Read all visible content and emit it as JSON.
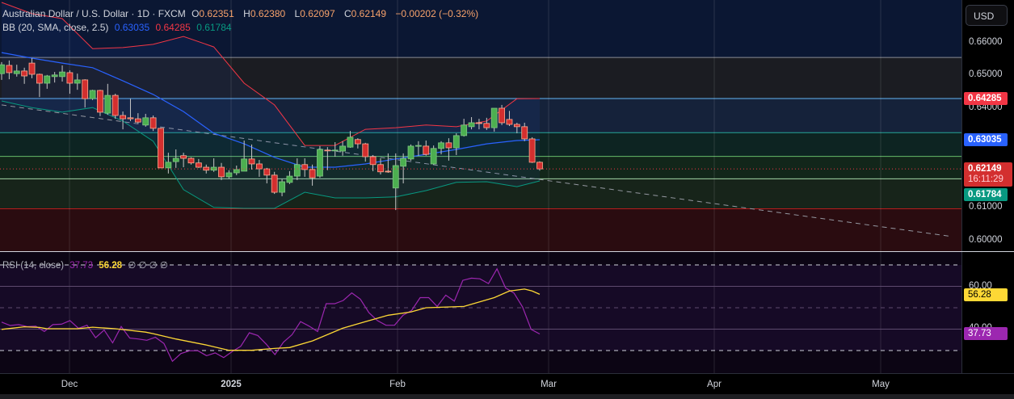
{
  "header": {
    "symbol_title": "Australian Dollar / U.S. Dollar · 1D · FXCM",
    "open_label": "O",
    "open": "0.62351",
    "high_label": "H",
    "high": "0.62380",
    "low_label": "L",
    "low": "0.62097",
    "close_label": "C",
    "close": "0.62149",
    "change": "−0.00202 (−0.32%)"
  },
  "bb_legend": {
    "label": "BB (20, SMA, close, 2.5)",
    "basis": "0.63035",
    "upper": "0.64285",
    "lower": "0.61784"
  },
  "rsi_legend": {
    "label": "RSI (14, close)",
    "rsi": "37.73",
    "ma": "56.28",
    "extras": "∅ ∅ ∅ ∅"
  },
  "price_axis": {
    "currency_button": "USD",
    "labels": [
      "0.66000",
      "0.65000",
      "0.64000",
      "0.61000",
      "0.60000"
    ],
    "badge_upper": "0.64285",
    "badge_basis": "0.63035",
    "badge_last": "0.62149",
    "badge_countdown": "16:11:29",
    "badge_lower": "0.61784"
  },
  "rsi_axis": {
    "labels": [
      "60.00",
      "40.00"
    ],
    "badge_ma": "56.28",
    "badge_rsi": "37.73"
  },
  "time_axis": {
    "labels": [
      "Dec",
      "2025",
      "Feb",
      "Mar",
      "Apr",
      "May"
    ]
  },
  "colors": {
    "up": "#4caf50",
    "down": "#f23645",
    "upper_band": "#f23645",
    "basis": "#2962ff",
    "lower_band": "#089981",
    "rsi": "#9c27b0",
    "rsi_ma": "#fdd835"
  },
  "chart_data": {
    "type": "candlestick",
    "price_range": [
      0.595,
      0.672
    ],
    "candles_ohlc": [
      [
        0.6504,
        0.6539,
        0.6485,
        0.6531
      ],
      [
        0.6529,
        0.6544,
        0.6487,
        0.6507
      ],
      [
        0.6504,
        0.6531,
        0.6495,
        0.6512
      ],
      [
        0.6512,
        0.6522,
        0.6473,
        0.6497
      ],
      [
        0.6536,
        0.6551,
        0.649,
        0.6502
      ],
      [
        0.6502,
        0.6504,
        0.6433,
        0.6475
      ],
      [
        0.6475,
        0.65,
        0.6458,
        0.6497
      ],
      [
        0.6495,
        0.6509,
        0.6477,
        0.65
      ],
      [
        0.6495,
        0.6529,
        0.648,
        0.6509
      ],
      [
        0.6507,
        0.6514,
        0.6443,
        0.6475
      ],
      [
        0.6475,
        0.6504,
        0.6455,
        0.6485
      ],
      [
        0.6485,
        0.6487,
        0.6401,
        0.6428
      ],
      [
        0.6428,
        0.6455,
        0.6424,
        0.6453
      ],
      [
        0.6453,
        0.6455,
        0.6375,
        0.6387
      ],
      [
        0.6384,
        0.6473,
        0.6379,
        0.6438
      ],
      [
        0.6438,
        0.6443,
        0.6367,
        0.6377
      ],
      [
        0.6377,
        0.6389,
        0.6335,
        0.6367
      ],
      [
        0.637,
        0.6428,
        0.636,
        0.6367
      ],
      [
        0.6367,
        0.6384,
        0.6353,
        0.6357
      ],
      [
        0.6348,
        0.6382,
        0.6343,
        0.637
      ],
      [
        0.637,
        0.6377,
        0.633,
        0.6338
      ],
      [
        0.6338,
        0.634,
        0.6218,
        0.6218
      ],
      [
        0.6218,
        0.6264,
        0.6201,
        0.6235
      ],
      [
        0.6237,
        0.6274,
        0.6218,
        0.6247
      ],
      [
        0.6255,
        0.6264,
        0.622,
        0.6247
      ],
      [
        0.6247,
        0.625,
        0.6228,
        0.6233
      ],
      [
        0.6233,
        0.6245,
        0.6218,
        0.622
      ],
      [
        0.622,
        0.6228,
        0.6201,
        0.6211
      ],
      [
        0.6211,
        0.6247,
        0.6206,
        0.622
      ],
      [
        0.622,
        0.6233,
        0.6181,
        0.6191
      ],
      [
        0.6191,
        0.6211,
        0.6186,
        0.6203
      ],
      [
        0.6203,
        0.6225,
        0.6196,
        0.6213
      ],
      [
        0.6208,
        0.6301,
        0.6208,
        0.6245
      ],
      [
        0.6245,
        0.6289,
        0.6213,
        0.623
      ],
      [
        0.623,
        0.6242,
        0.6191,
        0.6215
      ],
      [
        0.6215,
        0.6218,
        0.6171,
        0.6196
      ],
      [
        0.6196,
        0.6206,
        0.6139,
        0.6144
      ],
      [
        0.6144,
        0.6184,
        0.6132,
        0.6176
      ],
      [
        0.6174,
        0.6208,
        0.6169,
        0.6193
      ],
      [
        0.6193,
        0.6247,
        0.6181,
        0.6228
      ],
      [
        0.6228,
        0.6247,
        0.6191,
        0.6213
      ],
      [
        0.6213,
        0.6228,
        0.6164,
        0.6188
      ],
      [
        0.6193,
        0.6284,
        0.6188,
        0.6274
      ],
      [
        0.6272,
        0.6281,
        0.6211,
        0.627
      ],
      [
        0.627,
        0.6296,
        0.6252,
        0.6272
      ],
      [
        0.6269,
        0.6299,
        0.6255,
        0.6284
      ],
      [
        0.6281,
        0.633,
        0.6279,
        0.6311
      ],
      [
        0.6304,
        0.6308,
        0.6277,
        0.6291
      ],
      [
        0.6291,
        0.6294,
        0.6237,
        0.6252
      ],
      [
        0.6252,
        0.6257,
        0.6208,
        0.6228
      ],
      [
        0.6228,
        0.6247,
        0.6198,
        0.6206
      ],
      [
        0.6208,
        0.6262,
        0.6203,
        0.6206
      ],
      [
        0.6157,
        0.6262,
        0.609,
        0.6225
      ],
      [
        0.6223,
        0.6262,
        0.6171,
        0.6247
      ],
      [
        0.6245,
        0.6289,
        0.624,
        0.6284
      ],
      [
        0.6284,
        0.6299,
        0.6255,
        0.6286
      ],
      [
        0.6284,
        0.6301,
        0.6255,
        0.6259
      ],
      [
        0.623,
        0.6286,
        0.6228,
        0.6277
      ],
      [
        0.6277,
        0.6299,
        0.6259,
        0.6294
      ],
      [
        0.6294,
        0.6308,
        0.624,
        0.6279
      ],
      [
        0.6279,
        0.6323,
        0.6257,
        0.6316
      ],
      [
        0.6316,
        0.6367,
        0.6313,
        0.6348
      ],
      [
        0.6343,
        0.6372,
        0.6335,
        0.6355
      ],
      [
        0.6355,
        0.6367,
        0.6335,
        0.6353
      ],
      [
        0.6353,
        0.637,
        0.6333,
        0.634
      ],
      [
        0.634,
        0.6399,
        0.6328,
        0.6399
      ],
      [
        0.6399,
        0.6409,
        0.6348,
        0.6355
      ],
      [
        0.6365,
        0.6391,
        0.6345,
        0.635
      ],
      [
        0.635,
        0.6355,
        0.6323,
        0.6343
      ],
      [
        0.6343,
        0.6355,
        0.6299,
        0.6306
      ],
      [
        0.6306,
        0.6311,
        0.6233,
        0.6235
      ],
      [
        0.62351,
        0.6238,
        0.62097,
        0.62149
      ]
    ],
    "band_sample_indices": [
      0,
      4,
      8,
      12,
      16,
      20,
      24,
      28,
      32,
      36,
      40,
      44,
      48,
      52,
      56,
      60,
      64,
      68,
      71
    ],
    "bb_upper": [
      0.672,
      0.6686,
      0.6671,
      0.658,
      0.6583,
      0.6593,
      0.6617,
      0.6585,
      0.6475,
      0.6409,
      0.6286,
      0.6286,
      0.6335,
      0.634,
      0.6348,
      0.6343,
      0.636,
      0.6428,
      0.64285
    ],
    "bb_basis": [
      0.6568,
      0.6551,
      0.6536,
      0.6522,
      0.6482,
      0.6441,
      0.6389,
      0.6323,
      0.6291,
      0.625,
      0.622,
      0.622,
      0.623,
      0.6245,
      0.6259,
      0.6274,
      0.6291,
      0.6301,
      0.63035
    ],
    "bb_lower": [
      0.6421,
      0.6401,
      0.6387,
      0.6401,
      0.636,
      0.6299,
      0.6152,
      0.6098,
      0.6095,
      0.6095,
      0.6144,
      0.6127,
      0.6127,
      0.613,
      0.6149,
      0.6174,
      0.6176,
      0.6161,
      0.61784
    ],
    "levels": [
      0.6553,
      0.64285,
      0.6325,
      0.6253,
      0.6185,
      0.6094
    ],
    "trendline": [
      [
        0,
        0.6409
      ],
      [
        125,
        0.6011
      ]
    ],
    "rsi_range": [
      20,
      75
    ],
    "rsi_guides": [
      70,
      60,
      50,
      40,
      30
    ],
    "rsi": [
      43.3,
      41.7,
      42.1,
      41.2,
      41.4,
      38.9,
      42.1,
      42.3,
      44.0,
      40.4,
      41.8,
      36.0,
      39.6,
      33.6,
      41.2,
      35.8,
      35.4,
      34.8,
      36.2,
      33.3,
      25.0,
      28.6,
      29.9,
      29.9,
      27.6,
      28.9,
      26.7,
      29.5,
      32.0,
      38.3,
      37.0,
      32.9,
      28.1,
      33.9,
      37.4,
      43.5,
      41.4,
      38.9,
      51.9,
      51.9,
      53.4,
      56.9,
      54.0,
      47.7,
      44.0,
      41.8,
      41.8,
      46.5,
      48.7,
      54.7,
      54.7,
      50.6,
      55.9,
      53.1,
      62.8,
      63.8,
      63.5,
      61.3,
      68.2,
      59.3,
      56.8,
      50.3,
      39.9,
      37.73
    ],
    "rsi_ma": [
      [
        0,
        39.9
      ],
      [
        3,
        41.1
      ],
      [
        5,
        40.8
      ],
      [
        6,
        40.2
      ],
      [
        10,
        40.2
      ],
      [
        12,
        40.9
      ],
      [
        15,
        40.2
      ],
      [
        19,
        38.6
      ],
      [
        20,
        37.9
      ],
      [
        23,
        35.4
      ],
      [
        27,
        32.6
      ],
      [
        30,
        30.1
      ],
      [
        33,
        30.1
      ],
      [
        36,
        31.0
      ],
      [
        38,
        31.4
      ],
      [
        41,
        34.5
      ],
      [
        45,
        40.4
      ],
      [
        48,
        43.5
      ],
      [
        51,
        46.5
      ],
      [
        54,
        48.0
      ],
      [
        56,
        50.0
      ],
      [
        61,
        50.6
      ],
      [
        65,
        54.7
      ],
      [
        67,
        57.8
      ],
      [
        69,
        58.7
      ],
      [
        70,
        57.8
      ],
      [
        71,
        56.28
      ]
    ]
  }
}
